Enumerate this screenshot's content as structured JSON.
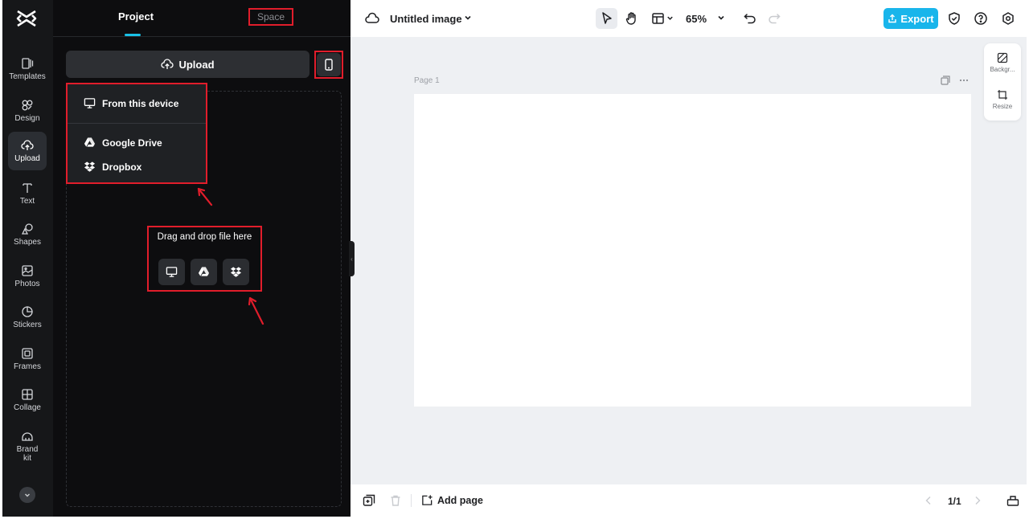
{
  "rail": {
    "items": [
      {
        "label": "Templates",
        "icon": "templates-icon"
      },
      {
        "label": "Design",
        "icon": "design-icon"
      },
      {
        "label": "Upload",
        "icon": "upload-icon"
      },
      {
        "label": "Text",
        "icon": "text-icon"
      },
      {
        "label": "Shapes",
        "icon": "shapes-icon"
      },
      {
        "label": "Photos",
        "icon": "photos-icon"
      },
      {
        "label": "Stickers",
        "icon": "stickers-icon"
      },
      {
        "label": "Frames",
        "icon": "frames-icon"
      },
      {
        "label": "Collage",
        "icon": "collage-icon"
      },
      {
        "label": "Brand kit",
        "icon": "brand-kit-icon"
      }
    ],
    "active": "Upload"
  },
  "panel": {
    "tabs": [
      {
        "label": "Project"
      },
      {
        "label": "Space"
      }
    ],
    "upload_label": "Upload",
    "menu": {
      "from_device": "From this device",
      "google_drive": "Google Drive",
      "dropbox": "Dropbox"
    },
    "drag_text": "Drag and drop file here"
  },
  "topbar": {
    "title": "Untitled image",
    "zoom": "65%",
    "export_label": "Export"
  },
  "canvas": {
    "page_label": "Page 1",
    "side_tools": [
      {
        "label": "Backgr..."
      },
      {
        "label": "Resize"
      }
    ]
  },
  "bottombar": {
    "add_page_label": "Add page",
    "pager": "1/1"
  },
  "colors": {
    "accent": "#19b5eb",
    "highlight": "#e11d2b",
    "panel_bg": "#0d0d0f",
    "rail_bg": "#161719"
  }
}
